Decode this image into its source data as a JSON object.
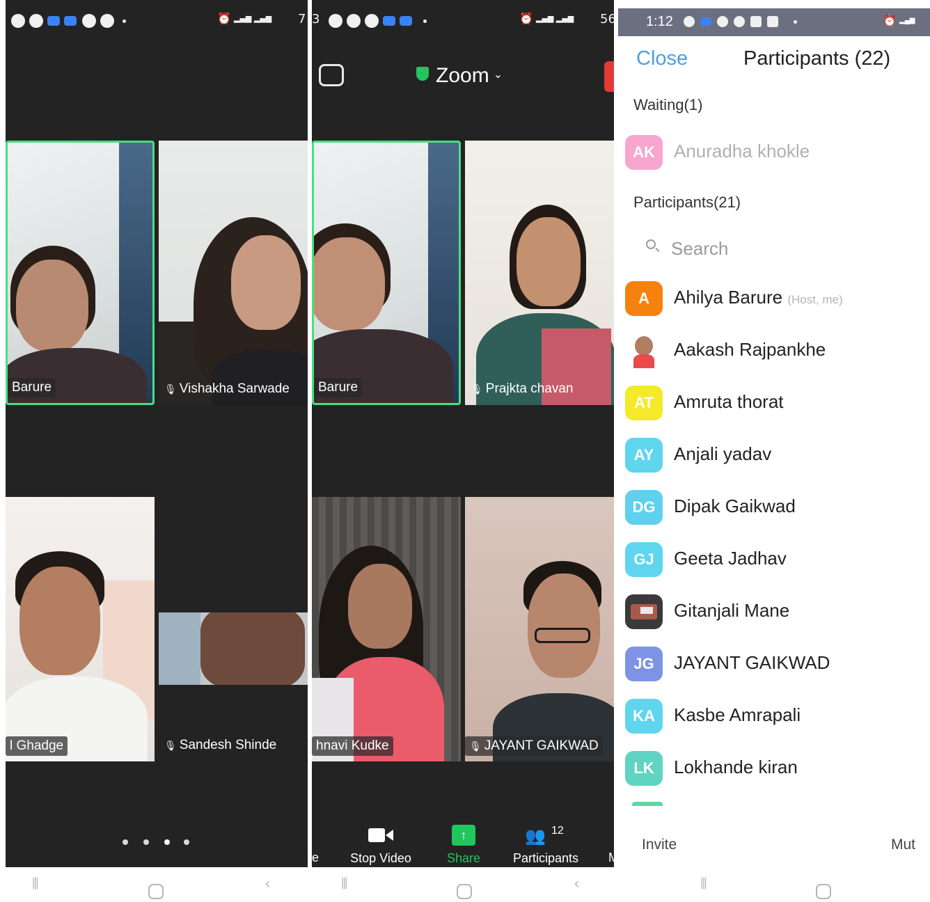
{
  "panel1": {
    "status": {
      "time_fragment": "7"
    },
    "tiles": [
      {
        "name": "Barure"
      },
      {
        "name": "Vishakha Sarwade"
      },
      {
        "name": "l Ghadge"
      },
      {
        "name": "Sandesh Shinde"
      }
    ]
  },
  "panel2": {
    "status": {
      "time_left": "3",
      "time_right": "56"
    },
    "header": {
      "title": "Zoom"
    },
    "tiles": [
      {
        "name": "Barure"
      },
      {
        "name": "Prajkta chavan"
      },
      {
        "name": "hnavi Kudke"
      },
      {
        "name": "JAYANT GAIKWAD"
      }
    ],
    "toolbar": {
      "left_cut": "e",
      "stop_video": "Stop Video",
      "share": "Share",
      "participants": "Participants",
      "participants_count": "12",
      "right_cut": "M"
    }
  },
  "panel3": {
    "status": {
      "time": "1:12"
    },
    "header": {
      "close": "Close",
      "title": "Participants (22)"
    },
    "waiting_label": "Waiting(1)",
    "waiting": [
      {
        "initials": "AK",
        "name": "Anuradha khokle",
        "color": "#f7a6cf"
      }
    ],
    "participants_label": "Participants(21)",
    "search_placeholder": "Search",
    "participants": [
      {
        "initials": "A",
        "name": "Ahilya Barure",
        "note": "(Host, me)",
        "color": "#f5820f"
      },
      {
        "initials": "",
        "name": "Aakash Rajpankhe",
        "color": "#ffffff"
      },
      {
        "initials": "AT",
        "name": "Amruta thorat",
        "color": "#f4ea2a"
      },
      {
        "initials": "AY",
        "name": "Anjali yadav",
        "color": "#5fd6ee"
      },
      {
        "initials": "DG",
        "name": "Dipak Gaikwad",
        "color": "#5fd0ee"
      },
      {
        "initials": "GJ",
        "name": "Geeta Jadhav",
        "color": "#5fd6ee"
      },
      {
        "initials": "",
        "name": "Gitanjali Mane",
        "color": "#3a3a3a"
      },
      {
        "initials": "JG",
        "name": "JAYANT GAIKWAD",
        "color": "#7f93e6"
      },
      {
        "initials": "KA",
        "name": "Kasbe Amrapali",
        "color": "#5fd6ee"
      },
      {
        "initials": "LK",
        "name": "Lokhande kiran",
        "color": "#5fd4c2"
      }
    ],
    "footer": {
      "invite": "Invite",
      "mute_cut": "Mut"
    }
  }
}
